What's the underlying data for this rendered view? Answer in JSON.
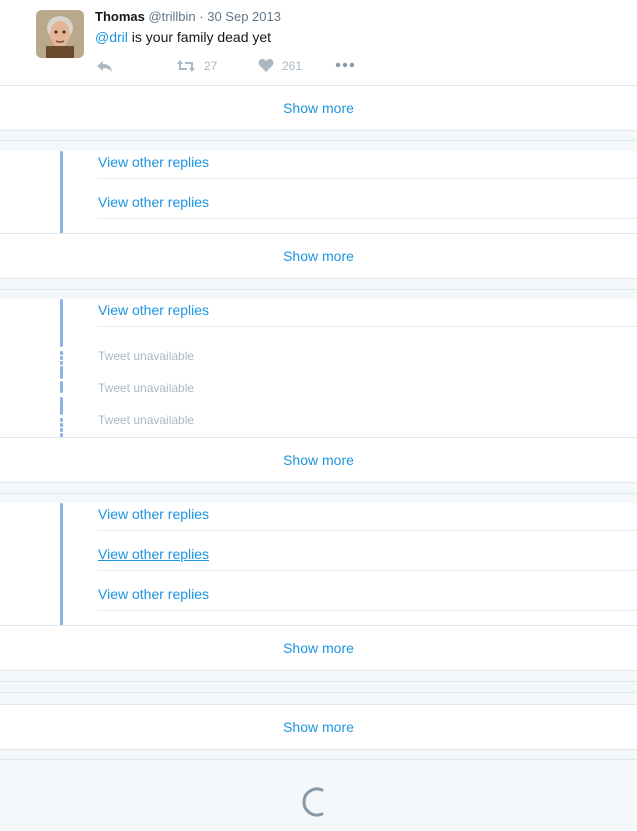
{
  "tweet": {
    "name": "Thomas",
    "handle": "@trillbin",
    "separator": "·",
    "date": "30 Sep 2013",
    "mention": "@dril",
    "text": " is your family dead yet",
    "retweets": "27",
    "likes": "261"
  },
  "labels": {
    "show_more": "Show more",
    "view_other_replies": "View other replies",
    "tweet_unavailable": "Tweet unavailable"
  },
  "colors": {
    "link": "#1b95e0",
    "thread_line": "#8ab4e3",
    "muted": "#aab8c2",
    "background": "#f5f8fa"
  },
  "icons": {
    "reply": "reply-icon",
    "retweet": "retweet-icon",
    "like": "heart-icon",
    "more": "more-icon",
    "loading": "loading-spinner-icon"
  }
}
